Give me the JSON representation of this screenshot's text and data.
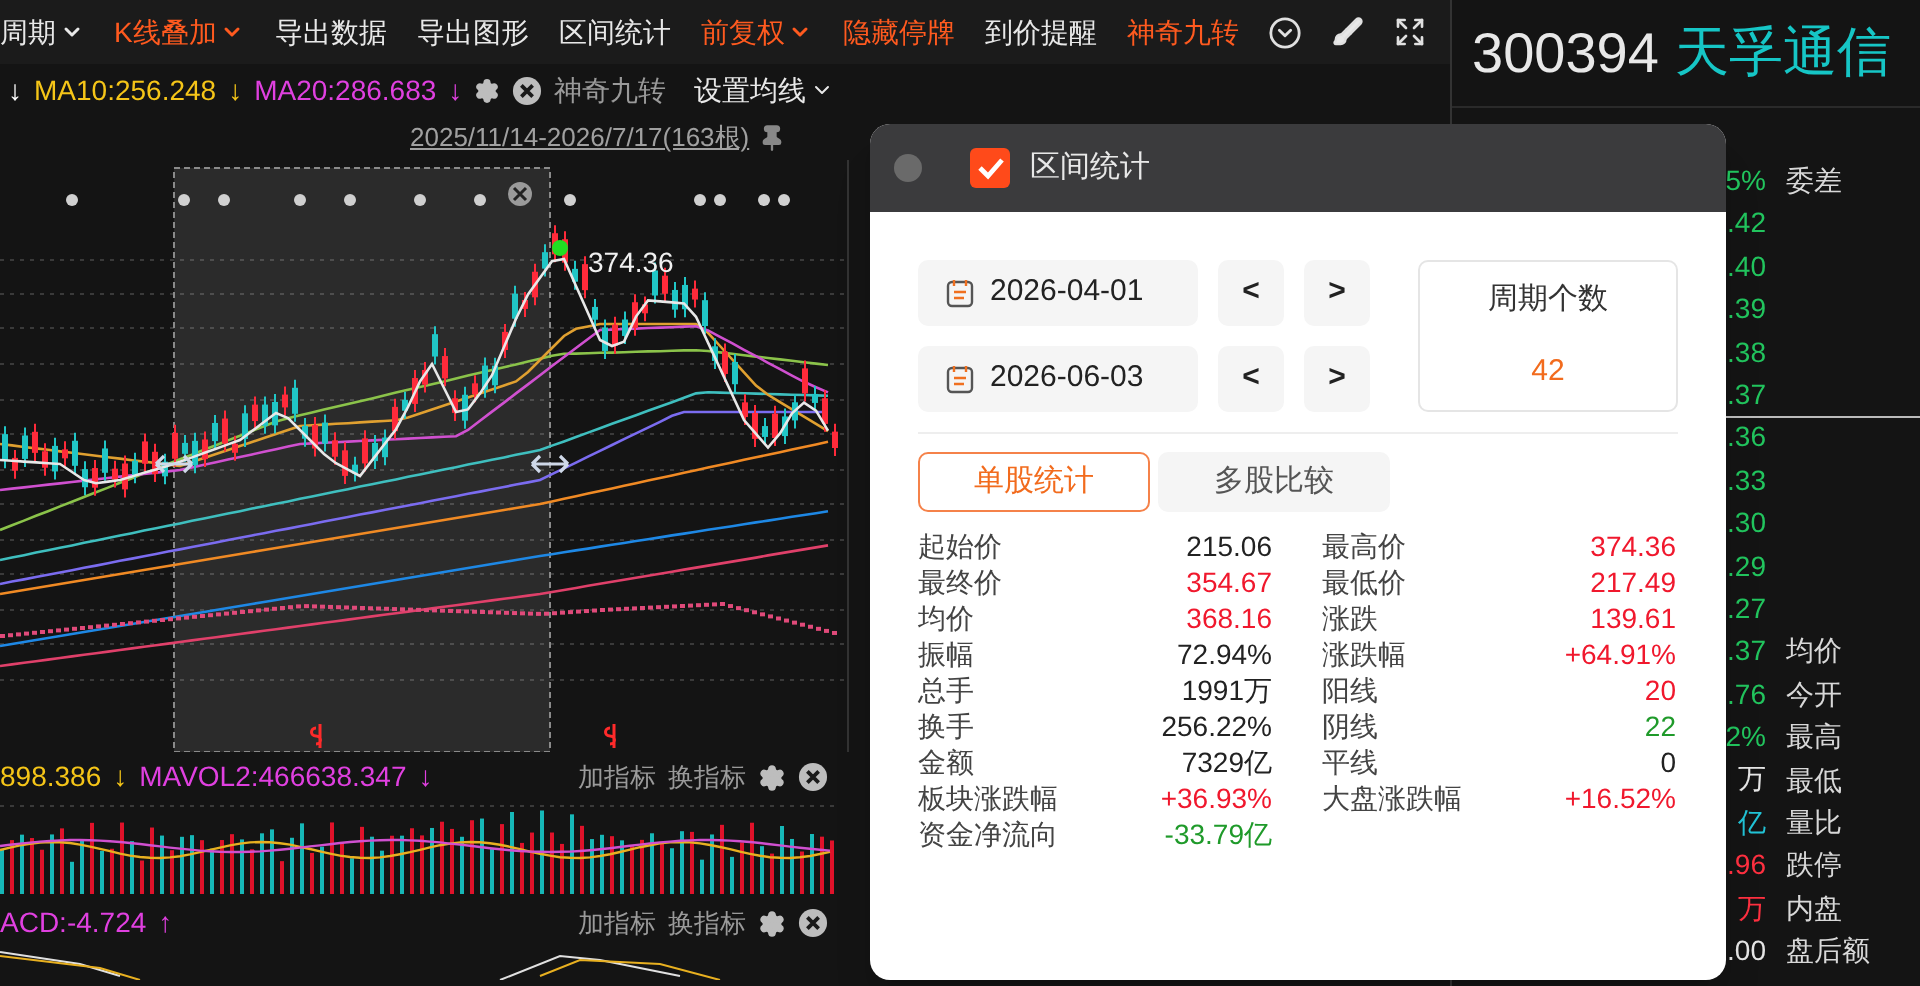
{
  "toolbar": [
    {
      "label": "周期",
      "kind": "menu",
      "active": false
    },
    {
      "label": "K线叠加",
      "kind": "menu",
      "active": true
    },
    {
      "label": "导出数据",
      "kind": "button",
      "active": false
    },
    {
      "label": "导出图形",
      "kind": "button",
      "active": false
    },
    {
      "label": "区间统计",
      "kind": "button",
      "active": false
    },
    {
      "label": "前复权",
      "kind": "menu",
      "active": true
    },
    {
      "label": "隐藏停牌",
      "kind": "button",
      "active": true
    },
    {
      "label": "到价提醒",
      "kind": "button",
      "active": false
    },
    {
      "label": "神奇九转",
      "kind": "button",
      "active": true
    }
  ],
  "ma_legend": [
    {
      "text": "↓",
      "color": "#ffffff"
    },
    {
      "text": "MA10:256.248",
      "color": "#f5c518"
    },
    {
      "text": "↓",
      "color": "#f5c518"
    },
    {
      "text": "MA20:286.683",
      "color": "#e040e0"
    },
    {
      "text": "↓",
      "color": "#e040e0"
    }
  ],
  "ma_indicator": "神奇九转",
  "ma_settings": "设置均线",
  "date_range": "2025/11/14-2026/7/17(163根)",
  "chart": {
    "price_label": "374.36"
  },
  "volume_legend": [
    {
      "text": "898.386",
      "color": "#f5c518"
    },
    {
      "text": "↓",
      "color": "#f5c518"
    },
    {
      "text": "MAVOL2:466638.347",
      "color": "#e040e0"
    },
    {
      "text": "↓",
      "color": "#e040e0"
    }
  ],
  "macd_legend": [
    {
      "text": "ACD:-4.724",
      "color": "#e040e0"
    },
    {
      "text": "↑",
      "color": "#e040e0"
    }
  ],
  "indicator_actions": [
    "加指标",
    "换指标"
  ],
  "indicator_actions_2": [
    "加指标",
    "换指标"
  ],
  "quote": {
    "code": "300394",
    "name": "天孚通信",
    "top_label": "委差",
    "labels": [
      "均价",
      "今开",
      "最高",
      "最低",
      "量比",
      "跌停",
      "内盘",
      "盘后额"
    ],
    "rows": [
      {
        "value": "5%",
        "color": "#22c55e"
      },
      {
        "value": ".42",
        "color": "#22c55e"
      },
      {
        "value": ".40",
        "color": "#22c55e"
      },
      {
        "value": ".39",
        "color": "#22c55e"
      },
      {
        "value": ".38",
        "color": "#22c55e"
      },
      {
        "value": ".37",
        "color": "#22c55e"
      },
      {
        "value": ".36",
        "color": "#22c55e"
      },
      {
        "value": ".33",
        "color": "#22c55e"
      },
      {
        "value": ".30",
        "color": "#22c55e"
      },
      {
        "value": ".29",
        "color": "#22c55e"
      },
      {
        "value": ".27",
        "color": "#22c55e"
      },
      {
        "value": ".37",
        "color": "#22c55e"
      },
      {
        "value": ".76",
        "color": "#22c55e"
      },
      {
        "value": "2%",
        "color": "#22c55e"
      },
      {
        "value": "万",
        "color": "#e5e5e5"
      },
      {
        "value": "亿",
        "color": "#22c3d6"
      },
      {
        "value": ".96",
        "color": "#ff3040"
      },
      {
        "value": "万",
        "color": "#ff3040"
      },
      {
        "value": ".00",
        "color": "#e5e5e5"
      }
    ]
  },
  "dialog": {
    "title": "区间统计",
    "start_date": "2026-04-01",
    "end_date": "2026-06-03",
    "prev": "<",
    "next": ">",
    "count_label": "周期个数",
    "count": "42",
    "tabs": [
      {
        "label": "单股统计",
        "selected": true
      },
      {
        "label": "多股比较",
        "selected": false
      }
    ],
    "stats_left": [
      {
        "label": "起始价",
        "value": "215.06",
        "color": "#222222"
      },
      {
        "label": "最终价",
        "value": "354.67",
        "color": "#f0182d"
      },
      {
        "label": "均价",
        "value": "368.16",
        "color": "#f0182d"
      },
      {
        "label": "振幅",
        "value": "72.94%",
        "color": "#222222"
      },
      {
        "label": "总手",
        "value": "1991万",
        "color": "#222222"
      },
      {
        "label": "换手",
        "value": "256.22%",
        "color": "#222222"
      },
      {
        "label": "金额",
        "value": "7329亿",
        "color": "#222222"
      },
      {
        "label": "板块涨跌幅",
        "value": "+36.93%",
        "color": "#f0182d"
      },
      {
        "label": "资金净流向",
        "value": "-33.79亿",
        "color": "#1f9a2a"
      }
    ],
    "stats_right": [
      {
        "label": "最高价",
        "value": "374.36",
        "color": "#f0182d"
      },
      {
        "label": "最低价",
        "value": "217.49",
        "color": "#f0182d"
      },
      {
        "label": "涨跌",
        "value": "139.61",
        "color": "#f0182d"
      },
      {
        "label": "涨跌幅",
        "value": "+64.91%",
        "color": "#f0182d"
      },
      {
        "label": "阳线",
        "value": "20",
        "color": "#f0182d"
      },
      {
        "label": "阴线",
        "value": "22",
        "color": "#1f9a2a"
      },
      {
        "label": "平线",
        "value": "0",
        "color": "#222222"
      },
      {
        "label": "大盘涨跌幅",
        "value": "+16.52%",
        "color": "#f0182d"
      }
    ]
  }
}
